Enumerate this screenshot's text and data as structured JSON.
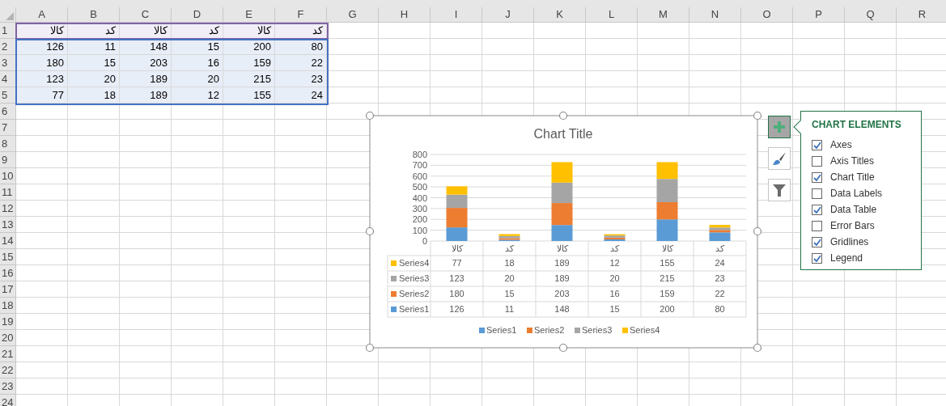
{
  "sheet": {
    "columns": [
      "A",
      "B",
      "C",
      "D",
      "E",
      "F",
      "G",
      "H",
      "I",
      "J",
      "K",
      "L",
      "M",
      "N",
      "O",
      "P",
      "Q",
      "R"
    ],
    "row_numbers": [
      "1",
      "2",
      "3",
      "4",
      "5",
      "6",
      "7",
      "8",
      "9",
      "10",
      "11",
      "12",
      "13",
      "14",
      "15",
      "16",
      "17",
      "18",
      "19",
      "20",
      "21",
      "22",
      "23",
      "24"
    ],
    "rows": [
      {
        "kind": "header",
        "cells": [
          "کالا",
          "کد",
          "کالا",
          "کد",
          "کالا",
          "کد"
        ]
      },
      {
        "kind": "data",
        "cells": [
          "126",
          "11",
          "148",
          "15",
          "200",
          "80"
        ]
      },
      {
        "kind": "data",
        "cells": [
          "180",
          "15",
          "203",
          "16",
          "159",
          "22"
        ]
      },
      {
        "kind": "data",
        "cells": [
          "123",
          "20",
          "189",
          "20",
          "215",
          "23"
        ]
      },
      {
        "kind": "data",
        "cells": [
          "77",
          "18",
          "189",
          "12",
          "155",
          "24"
        ]
      }
    ]
  },
  "chart": {
    "chart_data": {
      "type": "bar",
      "title": "Chart Title",
      "stacked": true,
      "orientation": "vertical",
      "categories": [
        "کالا",
        "کد",
        "کالا",
        "کد",
        "کالا",
        "کد"
      ],
      "series": [
        {
          "name": "Series1",
          "color": "#5b9bd5",
          "values": [
            126,
            11,
            148,
            15,
            200,
            80
          ]
        },
        {
          "name": "Series2",
          "color": "#ed7d31",
          "values": [
            180,
            15,
            203,
            16,
            159,
            22
          ]
        },
        {
          "name": "Series3",
          "color": "#a5a5a5",
          "values": [
            123,
            20,
            189,
            20,
            215,
            23
          ]
        },
        {
          "name": "Series4",
          "color": "#ffc000",
          "values": [
            77,
            18,
            189,
            12,
            155,
            24
          ]
        }
      ],
      "ylim": [
        0,
        800
      ],
      "yticks": [
        0,
        100,
        200,
        300,
        400,
        500,
        600,
        700,
        800
      ],
      "grid": true,
      "legend": true
    },
    "data_table": {
      "rows": [
        {
          "label": "Series4",
          "color": "#ffc000",
          "cells": [
            "77",
            "18",
            "189",
            "12",
            "155",
            "24"
          ]
        },
        {
          "label": "Series3",
          "color": "#a5a5a5",
          "cells": [
            "123",
            "20",
            "189",
            "20",
            "215",
            "23"
          ]
        },
        {
          "label": "Series2",
          "color": "#ed7d31",
          "cells": [
            "180",
            "15",
            "203",
            "16",
            "159",
            "22"
          ]
        },
        {
          "label": "Series1",
          "color": "#5b9bd5",
          "cells": [
            "126",
            "11",
            "148",
            "15",
            "200",
            "80"
          ]
        }
      ]
    }
  },
  "chart_elements": {
    "title": "CHART ELEMENTS",
    "items": [
      {
        "label": "Axes",
        "checked": true
      },
      {
        "label": "Axis Titles",
        "checked": false
      },
      {
        "label": "Chart Title",
        "checked": true
      },
      {
        "label": "Data Labels",
        "checked": false
      },
      {
        "label": "Data Table",
        "checked": true
      },
      {
        "label": "Error Bars",
        "checked": false
      },
      {
        "label": "Gridlines",
        "checked": true
      },
      {
        "label": "Legend",
        "checked": true
      }
    ]
  }
}
